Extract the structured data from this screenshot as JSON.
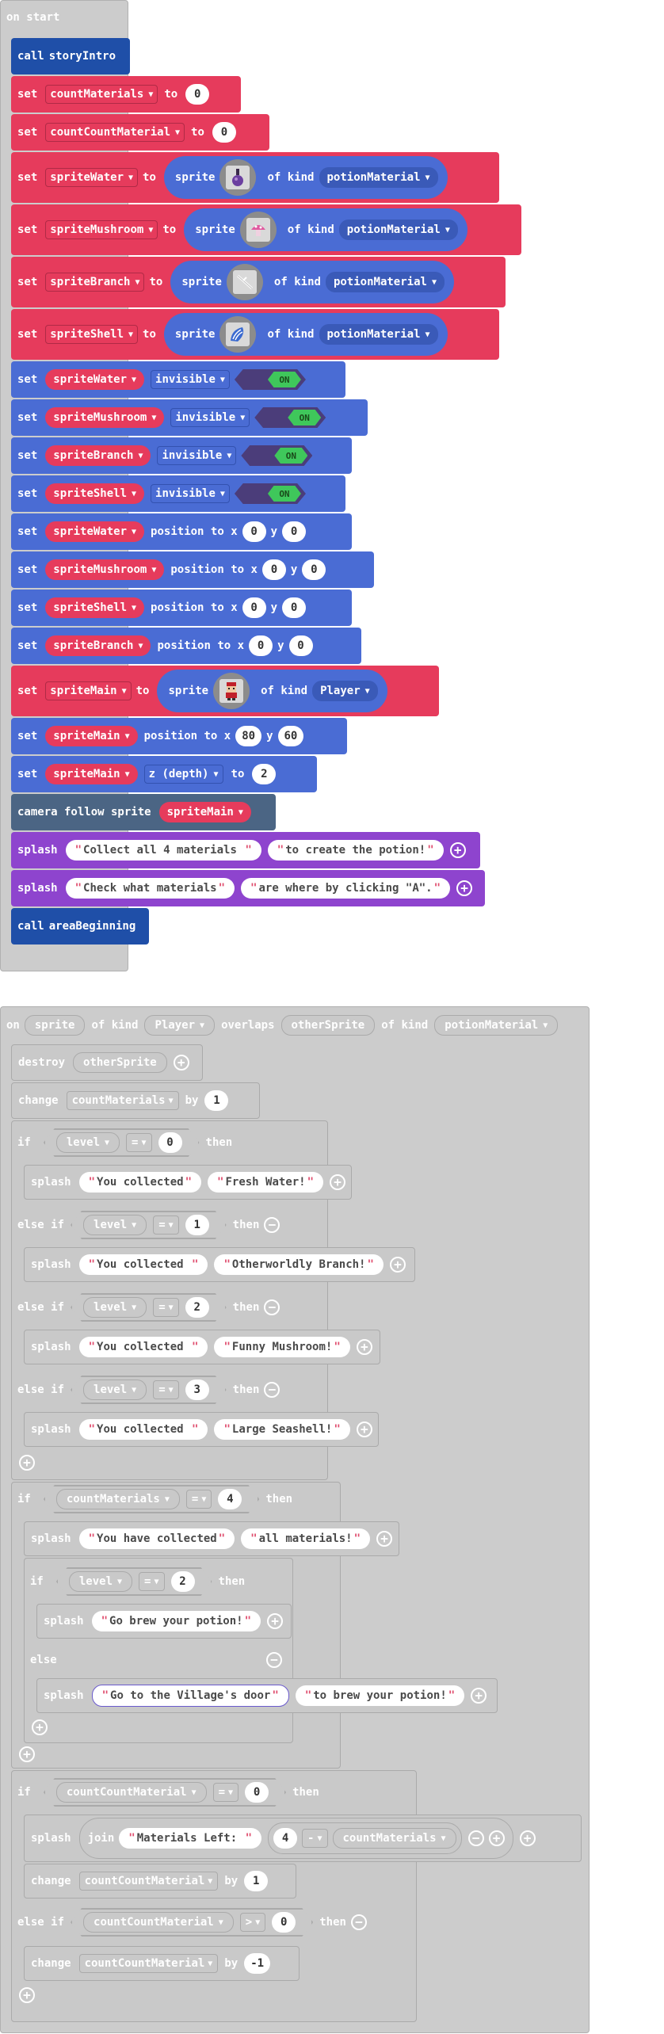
{
  "colors": {
    "events": "#cccccc",
    "functions": "#1f4fa8",
    "variables": "#e63b5c",
    "sprites": "#4a6cd4",
    "scene": "#4b6584",
    "game": "#8e44ce",
    "disabled": "#c9c9c9"
  },
  "on_start": {
    "label": "on start",
    "call_story": {
      "kw": "call",
      "name": "storyIntro"
    },
    "set_count_materials": {
      "kw": "set",
      "var": "countMaterials",
      "to": "to",
      "value": "0"
    },
    "set_count_count": {
      "kw": "set",
      "var": "countCountMaterial",
      "to": "to",
      "value": "0"
    },
    "create_sprites": [
      {
        "kw": "set",
        "var": "spriteWater",
        "to": "to",
        "sprite": "sprite",
        "of_kind": "of kind",
        "kind": "potionMaterial",
        "icon": "water-potion-icon"
      },
      {
        "kw": "set",
        "var": "spriteMushroom",
        "to": "to",
        "sprite": "sprite",
        "of_kind": "of kind",
        "kind": "potionMaterial",
        "icon": "mushroom-icon"
      },
      {
        "kw": "set",
        "var": "spriteBranch",
        "to": "to",
        "sprite": "sprite",
        "of_kind": "of kind",
        "kind": "potionMaterial",
        "icon": "branch-icon"
      },
      {
        "kw": "set",
        "var": "spriteShell",
        "to": "to",
        "sprite": "sprite",
        "of_kind": "of kind",
        "kind": "potionMaterial",
        "icon": "seashell-icon"
      }
    ],
    "invisible_rows": [
      {
        "kw": "set",
        "var": "spriteWater",
        "prop": "invisible",
        "toggle": "ON"
      },
      {
        "kw": "set",
        "var": "spriteMushroom",
        "prop": "invisible",
        "toggle": "ON"
      },
      {
        "kw": "set",
        "var": "spriteBranch",
        "prop": "invisible",
        "toggle": "ON"
      },
      {
        "kw": "set",
        "var": "spriteShell",
        "prop": "invisible",
        "toggle": "ON"
      }
    ],
    "position_rows": [
      {
        "kw": "set",
        "var": "spriteWater",
        "pos": "position to x",
        "x": "0",
        "y_label": "y",
        "y": "0"
      },
      {
        "kw": "set",
        "var": "spriteMushroom",
        "pos": "position to x",
        "x": "0",
        "y_label": "y",
        "y": "0"
      },
      {
        "kw": "set",
        "var": "spriteShell",
        "pos": "position to x",
        "x": "0",
        "y_label": "y",
        "y": "0"
      },
      {
        "kw": "set",
        "var": "spriteBranch",
        "pos": "position to x",
        "x": "0",
        "y_label": "y",
        "y": "0"
      }
    ],
    "set_main": {
      "kw": "set",
      "var": "spriteMain",
      "to": "to",
      "sprite": "sprite",
      "of_kind": "of kind",
      "kind": "Player",
      "icon": "player-icon"
    },
    "main_position": {
      "kw": "set",
      "var": "spriteMain",
      "pos": "position to x",
      "x": "80",
      "y_label": "y",
      "y": "60"
    },
    "main_z": {
      "kw": "set",
      "var": "spriteMain",
      "prop": "z (depth)",
      "to": "to",
      "value": "2"
    },
    "camera": {
      "label": "camera follow sprite",
      "var": "spriteMain"
    },
    "splashes": [
      {
        "kw": "splash",
        "a": "Collect all 4 materials ",
        "b": "to create the potion!"
      },
      {
        "kw": "splash",
        "a": "Check what materials",
        "b": "are where by clicking \"A\"."
      }
    ],
    "call_area": {
      "kw": "call",
      "name": "areaBeginning"
    }
  },
  "overlap": {
    "on": "on",
    "sprite": "sprite",
    "of_kind_1": "of kind",
    "kind_1": "Player",
    "overlaps": "overlaps",
    "other": "otherSprite",
    "of_kind_2": "of kind",
    "kind_2": "potionMaterial",
    "destroy": {
      "kw": "destroy",
      "var": "otherSprite"
    },
    "change": {
      "kw": "change",
      "var": "countMaterials",
      "by": "by",
      "value": "1"
    },
    "level_ifs": [
      {
        "kw": "if",
        "var": "level",
        "op": "=",
        "value": "0",
        "then": "then",
        "splash": "splash",
        "a": "You collected",
        "b": "Fresh Water!"
      },
      {
        "kw": "else if",
        "var": "level",
        "op": "=",
        "value": "1",
        "then": "then",
        "splash": "splash",
        "a": "You collected ",
        "b": "Otherworldly Branch!"
      },
      {
        "kw": "else if",
        "var": "level",
        "op": "=",
        "value": "2",
        "then": "then",
        "splash": "splash",
        "a": "You collected ",
        "b": "Funny Mushroom!"
      },
      {
        "kw": "else if",
        "var": "level",
        "op": "=",
        "value": "3",
        "then": "then",
        "splash": "splash",
        "a": "You collected ",
        "b": "Large Seashell!"
      }
    ],
    "all_if": {
      "kw": "if",
      "var": "countMaterials",
      "op": "=",
      "value": "4",
      "then": "then"
    },
    "all_splash": {
      "kw": "splash",
      "a": "You have collected",
      "b": "all materials!"
    },
    "inner_if": {
      "kw": "if",
      "var": "level",
      "op": "=",
      "value": "2",
      "then": "then"
    },
    "brew_splash": {
      "kw": "splash",
      "a": "Go brew your potion!"
    },
    "else_label": "else",
    "village_splash": {
      "kw": "splash",
      "a": "Go to the Village's door",
      "b": "to brew your potion!"
    },
    "cc_if": {
      "kw": "if",
      "var": "countCountMaterial",
      "op": "=",
      "value": "0",
      "then": "then"
    },
    "left_splash": {
      "kw": "splash",
      "join": "join",
      "a": "Materials Left: ",
      "n": "4",
      "op": "-",
      "var": "countMaterials"
    },
    "cc_change1": {
      "kw": "change",
      "var": "countCountMaterial",
      "by": "by",
      "value": "1"
    },
    "cc_elseif": {
      "kw": "else if",
      "var": "countCountMaterial",
      "op": ">",
      "value": "0",
      "then": "then"
    },
    "cc_change2": {
      "kw": "change",
      "var": "countCountMaterial",
      "by": "by",
      "value": "-1"
    }
  }
}
